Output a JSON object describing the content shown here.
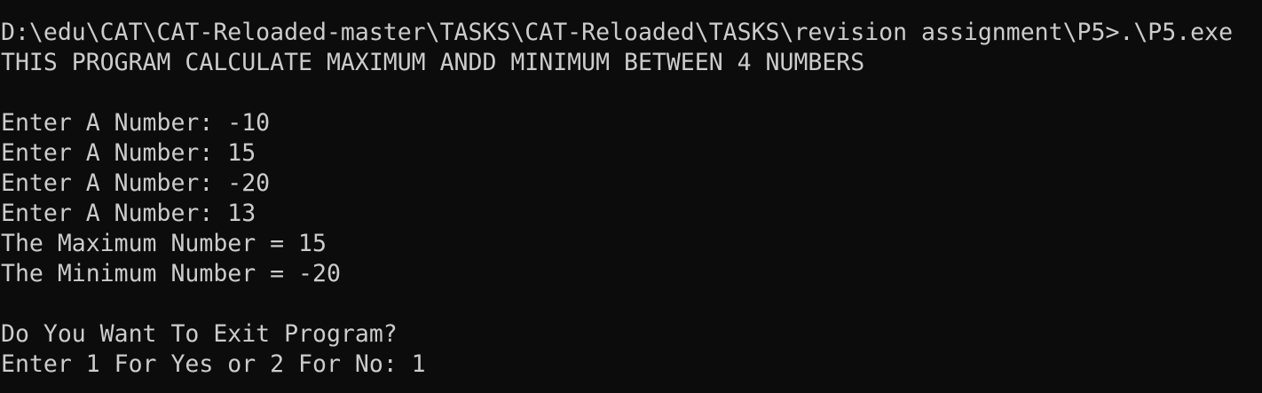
{
  "console": {
    "background": "#0c0c0c",
    "foreground": "#cccccc",
    "lines": [
      "D:\\edu\\CAT\\CAT-Reloaded-master\\TASKS\\CAT-Reloaded\\TASKS\\revision assignment\\P5>.\\P5.exe",
      "THIS PROGRAM CALCULATE MAXIMUM ANDD MINIMUM BETWEEN 4 NUMBERS",
      "",
      "Enter A Number: -10",
      "Enter A Number: 15",
      "Enter A Number: -20",
      "Enter A Number: 13",
      "The Maximum Number = 15",
      "The Minimum Number = -20",
      "",
      "Do You Want To Exit Program?",
      "Enter 1 For Yes or 2 For No: 1"
    ]
  }
}
